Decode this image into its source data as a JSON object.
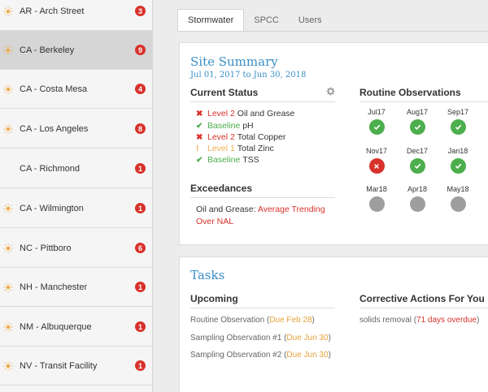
{
  "sidebar": {
    "sites": [
      {
        "name": "AR - Arch Street",
        "count": "3",
        "icon": "sun-icon",
        "selected": false
      },
      {
        "name": "CA - Berkeley",
        "count": "9",
        "icon": "sun-icon",
        "selected": true
      },
      {
        "name": "CA - Costa Mesa",
        "count": "4",
        "icon": "sun-icon",
        "selected": false
      },
      {
        "name": "CA - Los Angeles",
        "count": "8",
        "icon": "sun-icon",
        "selected": false
      },
      {
        "name": "CA - Richmond",
        "count": "1",
        "icon": "",
        "selected": false
      },
      {
        "name": "CA - Wilmington",
        "count": "1",
        "icon": "sun-icon",
        "selected": false
      },
      {
        "name": "NC - Pittboro",
        "count": "6",
        "icon": "sun-icon",
        "selected": false
      },
      {
        "name": "NH - Manchester",
        "count": "1",
        "icon": "sun-icon",
        "selected": false
      },
      {
        "name": "NM - Albuquerque",
        "count": "1",
        "icon": "sun-icon",
        "selected": false
      },
      {
        "name": "NV - Transit Facility",
        "count": "1",
        "icon": "sun-icon",
        "selected": false
      }
    ]
  },
  "tabs": [
    {
      "label": "Stormwater",
      "active": true
    },
    {
      "label": "SPCC",
      "active": false
    },
    {
      "label": "Users",
      "active": false
    }
  ],
  "summary": {
    "title": "Site Summary",
    "dates": "Jul 01, 2017 to Jun 30, 2018",
    "current_status": {
      "heading": "Current Status",
      "items": [
        {
          "mark": "x",
          "level": "Level 2",
          "param": "Oil and Grease",
          "color": "#d7322b"
        },
        {
          "mark": "check",
          "level": "Baseline",
          "param": "pH",
          "color": "#4cae4c"
        },
        {
          "mark": "x",
          "level": "Level 2",
          "param": "Total Copper",
          "color": "#d7322b"
        },
        {
          "mark": "!",
          "level": "Level 1",
          "param": "Total Zinc",
          "color": "#f0ad4e"
        },
        {
          "mark": "check",
          "level": "Baseline",
          "param": "TSS",
          "color": "#4cae4c"
        }
      ]
    },
    "exceedances": {
      "heading": "Exceedances",
      "param": "Oil and Grease:",
      "status": "Average Trending Over NAL"
    },
    "routine": {
      "heading": "Routine Observations",
      "months": [
        {
          "label": "Jul17",
          "state": "ok"
        },
        {
          "label": "Aug17",
          "state": "ok"
        },
        {
          "label": "Sep17",
          "state": "ok"
        },
        {
          "label": "Nov17",
          "state": "bad"
        },
        {
          "label": "Dec17",
          "state": "ok"
        },
        {
          "label": "Jan18",
          "state": "ok"
        },
        {
          "label": "Mar18",
          "state": "pending"
        },
        {
          "label": "Apr18",
          "state": "pending"
        },
        {
          "label": "May18",
          "state": "pending"
        }
      ]
    }
  },
  "tasks": {
    "title": "Tasks",
    "upcoming": {
      "heading": "Upcoming",
      "items": [
        {
          "name": "Routine Observation",
          "due": "Due Feb 28"
        },
        {
          "name": "Sampling Observation #1",
          "due": "Due Jun 30"
        },
        {
          "name": "Sampling Observation #2",
          "due": "Due Jun 30"
        }
      ]
    },
    "corrective": {
      "heading": "Corrective Actions For You",
      "items": [
        {
          "name": "solids removal",
          "due": "71 days overdue"
        }
      ]
    }
  },
  "colors": {
    "accent": "#3a8fc7",
    "danger": "#d7322b",
    "success": "#4cae4c",
    "warning": "#f0ad4e",
    "pending": "#9e9e9e"
  }
}
